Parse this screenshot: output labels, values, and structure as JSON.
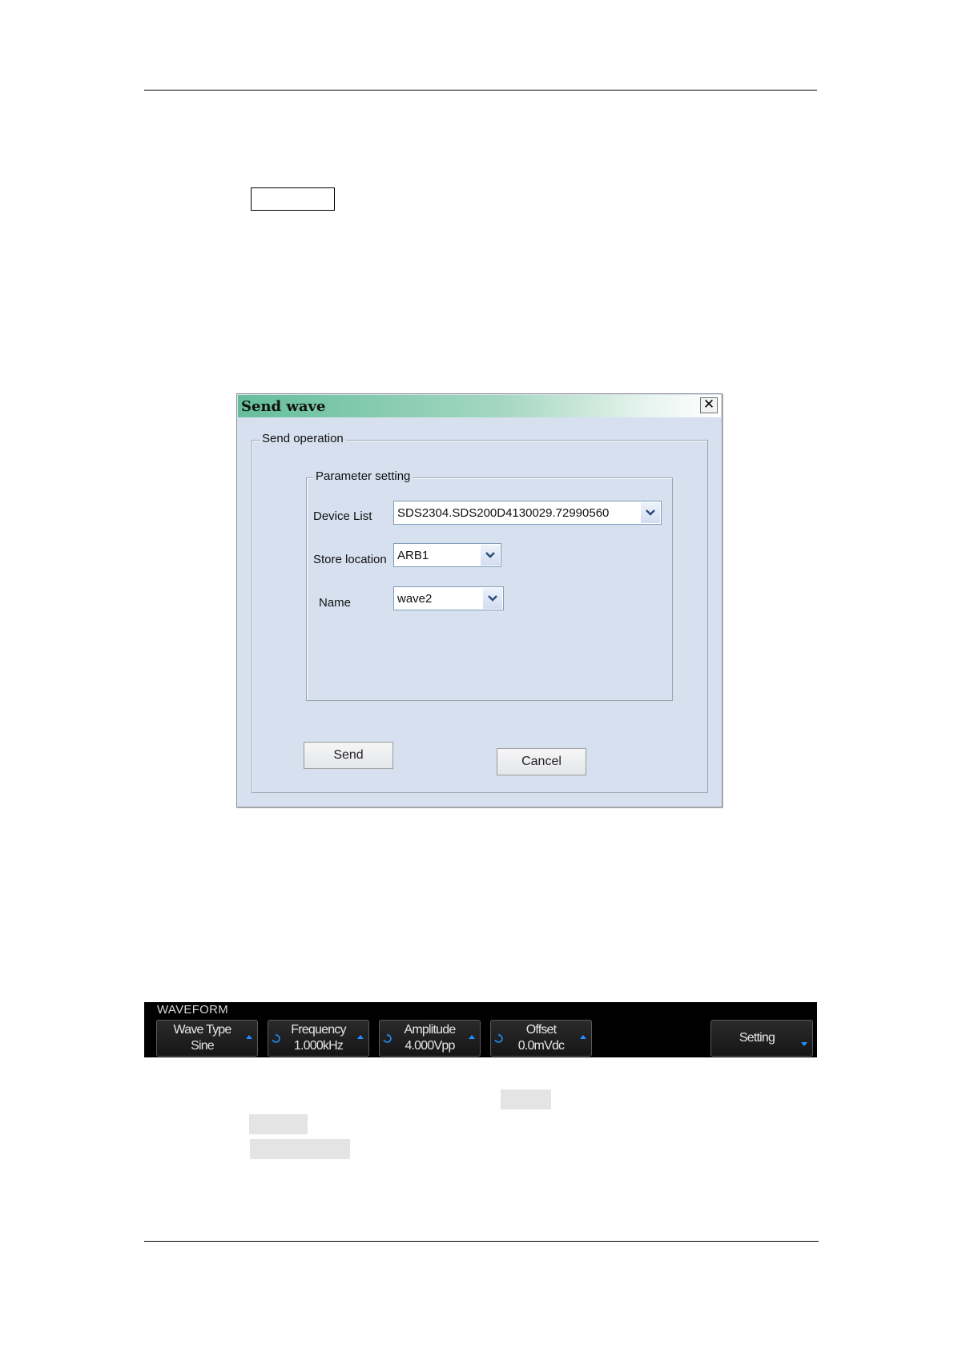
{
  "dialog": {
    "title": "Send  wave",
    "close_glyph": "✕",
    "send_operation_legend": "Send operation",
    "parameter_setting_legend": "Parameter  setting",
    "device_list_label": "Device List",
    "device_list_value": "SDS2304.SDS200D4130029.72990560",
    "store_location_label": "Store location",
    "store_location_value": "ARB1",
    "name_label": "Name",
    "name_value": "wave2",
    "send_button": "Send",
    "cancel_button": "Cancel"
  },
  "waveform_menu": {
    "title": "WAVEFORM",
    "softkeys": [
      {
        "line1": "Wave Type",
        "line2": "Sine"
      },
      {
        "line1": "Frequency",
        "line2": "1.000kHz"
      },
      {
        "line1": "Amplitude",
        "line2": "4.000Vpp"
      },
      {
        "line1": "Offset",
        "line2": "0.0mVdc"
      },
      {
        "line1": "Setting"
      }
    ]
  },
  "colors": {
    "title_gradient_start": "#64be9c",
    "dialog_background": "#d6e0ef",
    "softkey_arrow": "#1e90ff"
  },
  "icons": [
    "close-icon",
    "chevron-down-icon",
    "rotary-knob-icon",
    "arrow-indicator-icon"
  ]
}
